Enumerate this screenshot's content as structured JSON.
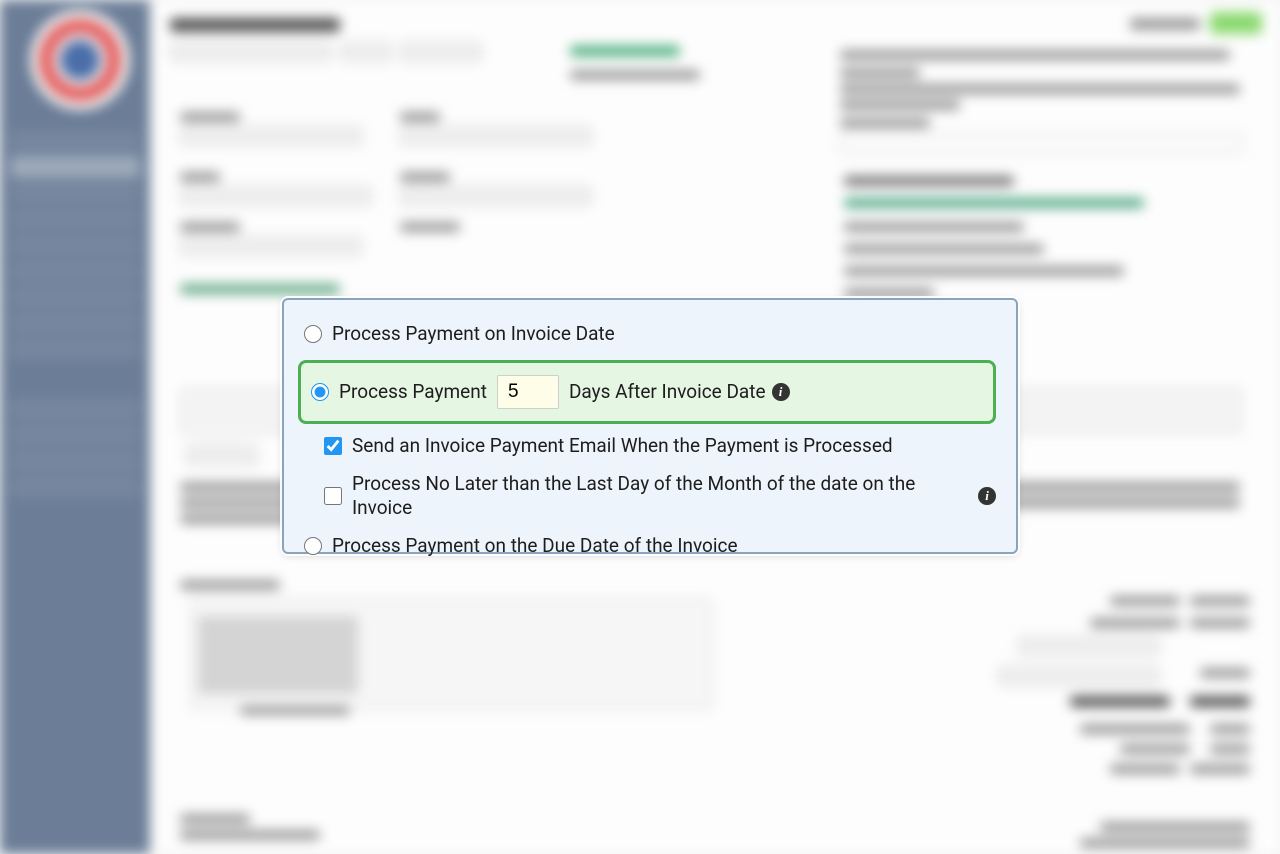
{
  "panel": {
    "opt_invoice_date": "Process Payment on Invoice Date",
    "opt_days_prefix": "Process Payment",
    "days_value": "5",
    "opt_days_suffix": "Days After Invoice Date",
    "chk_email": "Send an Invoice Payment Email When the Payment is Processed",
    "chk_last_day": "Process No Later than the Last Day of the Month of the date on the Invoice",
    "opt_due_date": "Process Payment on the Due Date of the Invoice"
  }
}
